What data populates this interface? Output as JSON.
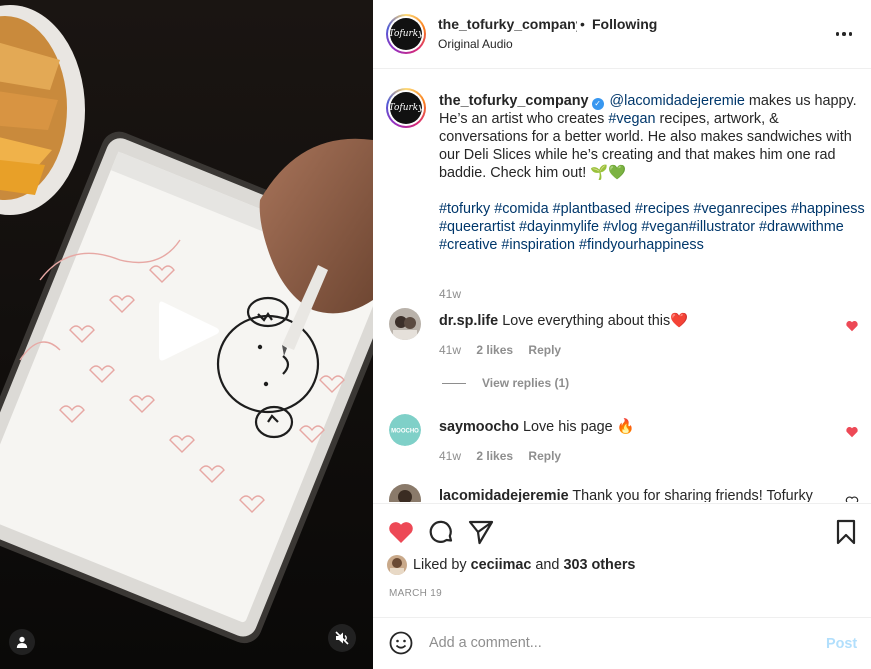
{
  "media": {
    "play_icon": "play-icon",
    "user_tag_icon": "user-icon",
    "mute_icon": "speaker-muted-icon"
  },
  "header": {
    "avatar_text": "Tofurky",
    "username": "the_tofurky_company",
    "separator": "•",
    "follow_status": "Following",
    "audio": "Original Audio",
    "more_icon": "more-horizontal-icon"
  },
  "caption": {
    "avatar_text": "Tofurky",
    "username": "the_tofurky_company",
    "verified_icon": "verified-badge-icon",
    "mention": "@lacomidadejeremie",
    "t1": " makes us happy. He’s an artist who creates ",
    "vegan_tag": "#vegan",
    "t2": " recipes, artwork, & conversations for a better world. He also makes sandwiches with our Deli Slices while he’s creating and that makes him one rad baddie. Check him out! 🌱💚",
    "hashtags": [
      "#tofurky",
      "#comida",
      "#plantbased",
      "#recipes",
      "#veganrecipes",
      "#happiness",
      "#queerartist",
      "#dayinmylife",
      "#vlog",
      "#vegan",
      "#illustrator",
      "#drawwithme",
      "#creative",
      "#inspiration",
      "#findyourhappiness"
    ],
    "age": "41w"
  },
  "comments": [
    {
      "username": "dr.sp.life",
      "text": "Love everything about this❤️",
      "age": "41w",
      "likes": "2 likes",
      "reply": "Reply",
      "heart_color": "#ed4956"
    },
    {
      "username": "saymoocho",
      "text": "Love his page 🔥",
      "age": "41w",
      "likes": "2 likes",
      "reply": "Reply",
      "heart_color": "#ed4956",
      "avatar_text": "MOOCHO"
    },
    {
      "username": "lacomidadejeremie",
      "text": "Thank you for sharing friends! Tofurky"
    }
  ],
  "view_replies": "View replies (1)",
  "actions": {
    "like_icon": "heart-filled-icon",
    "like_color": "#ed4956",
    "comment_icon": "comment-icon",
    "share_icon": "send-icon",
    "save_icon": "bookmark-icon"
  },
  "liked_by": {
    "prefix": "Liked by ",
    "user": "ceciimac",
    "mid": " and ",
    "others": "303 others"
  },
  "date": "MARCH 19",
  "add_comment": {
    "emoji_icon": "smiley-icon",
    "placeholder": "Add a comment...",
    "post_label": "Post",
    "post_color": "#b2dffc"
  }
}
